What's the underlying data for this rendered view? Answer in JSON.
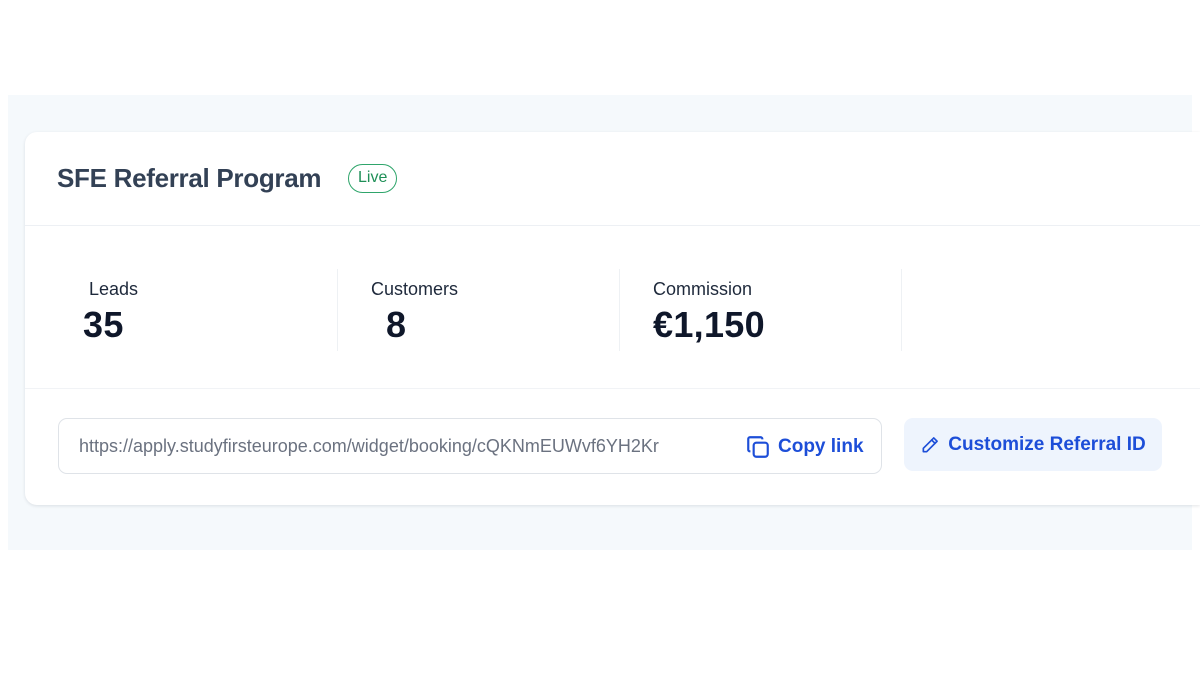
{
  "program": {
    "title": "SFE Referral Program",
    "status_badge": "Live"
  },
  "stats": [
    {
      "label": "Leads",
      "value": "35"
    },
    {
      "label": "Customers",
      "value": "8"
    },
    {
      "label": "Commission",
      "value": "€1,150"
    }
  ],
  "referral": {
    "link": "https://apply.studyfirsteurope.com/widget/booking/cQKNmEUWvf6YH2Kr",
    "copy_label": "Copy link",
    "customize_label": "Customize Referral ID"
  },
  "icons": {
    "copy": "copy-icon",
    "edit": "pencil-icon"
  },
  "colors": {
    "accent": "#1d4ed8",
    "live": "#2fa56b",
    "title": "#334155",
    "button_bg": "#eef4fd"
  }
}
